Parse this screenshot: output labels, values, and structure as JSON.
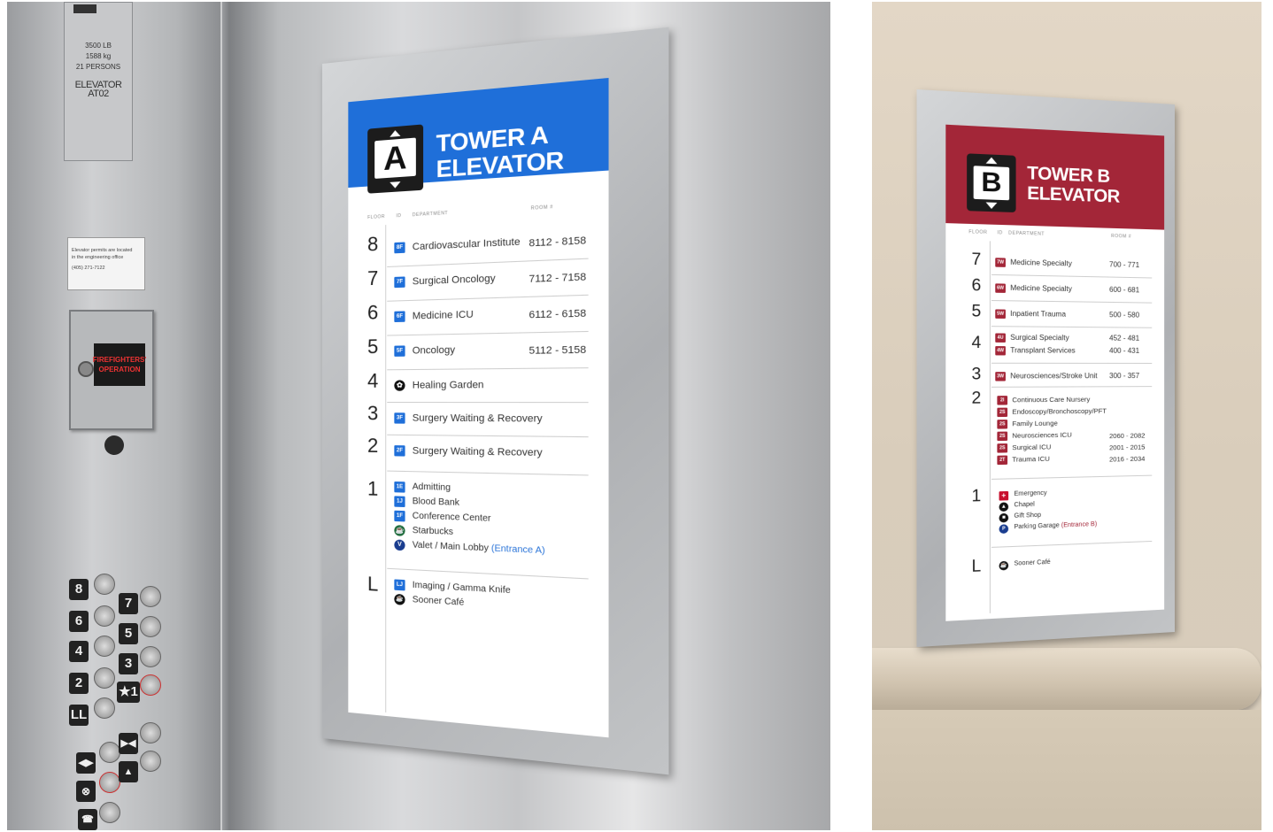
{
  "photo_a": {
    "elevator_panel": {
      "capacity_lines": [
        "3500 LB",
        "1588 kg",
        "21 PERSONS"
      ],
      "elevator_id": "ELEVATOR AT02",
      "notice_lines": [
        "Elevator permits are located",
        "in the engineering office",
        "(405) 271-7122"
      ],
      "fire_label_lines": [
        "FIREFIGHTERS'",
        "OPERATION"
      ],
      "buttons": [
        "8",
        "7",
        "6",
        "5",
        "4",
        "3",
        "2",
        "★1",
        "LL"
      ]
    },
    "sign": {
      "accent_color": "#1f6fd9",
      "emblem_letter": "A",
      "title_lines": [
        "TOWER A",
        "ELEVATOR"
      ],
      "columns": [
        "FLOOR",
        "ID",
        "DEPARTMENT",
        "ROOM #"
      ],
      "floors": [
        {
          "floor": "8",
          "items": [
            {
              "id": "8F",
              "dept": "Cardiovascular Institute",
              "room": "8112 - 8158"
            }
          ]
        },
        {
          "floor": "7",
          "items": [
            {
              "id": "7F",
              "dept": "Surgical Oncology",
              "room": "7112 - 7158"
            }
          ]
        },
        {
          "floor": "6",
          "items": [
            {
              "id": "6F",
              "dept": "Medicine ICU",
              "room": "6112 - 6158"
            }
          ]
        },
        {
          "floor": "5",
          "items": [
            {
              "id": "5F",
              "dept": "Oncology",
              "room": "5112 - 5158"
            }
          ]
        },
        {
          "floor": "4",
          "items": [
            {
              "id": "garden-icon",
              "dept": "Healing Garden",
              "room": ""
            }
          ]
        },
        {
          "floor": "3",
          "items": [
            {
              "id": "3F",
              "dept": "Surgery Waiting & Recovery",
              "room": ""
            }
          ]
        },
        {
          "floor": "2",
          "items": [
            {
              "id": "2F",
              "dept": "Surgery Waiting & Recovery",
              "room": ""
            }
          ]
        },
        {
          "floor": "1",
          "items": [
            {
              "id": "1E",
              "dept": "Admitting",
              "room": ""
            },
            {
              "id": "1J",
              "dept": "Blood Bank",
              "room": ""
            },
            {
              "id": "1F",
              "dept": "Conference Center",
              "room": ""
            },
            {
              "id": "starbucks-icon",
              "dept": "Starbucks",
              "room": ""
            },
            {
              "id": "valet-icon",
              "dept": "Valet / Main Lobby",
              "room": "",
              "note": "(Entrance A)"
            }
          ]
        },
        {
          "floor": "L",
          "items": [
            {
              "id": "LJ",
              "dept": "Imaging / Gamma Knife",
              "room": ""
            },
            {
              "id": "cafe-icon",
              "dept": "Sooner Café",
              "room": ""
            }
          ]
        }
      ]
    }
  },
  "photo_b": {
    "sign": {
      "accent_color": "#a32638",
      "emblem_letter": "B",
      "title_lines": [
        "TOWER B",
        "ELEVATOR"
      ],
      "columns": [
        "FLOOR",
        "ID",
        "DEPARTMENT",
        "ROOM #"
      ],
      "floors": [
        {
          "floor": "7",
          "items": [
            {
              "id": "7W",
              "dept": "Medicine Specialty",
              "room": "700 - 771"
            }
          ]
        },
        {
          "floor": "6",
          "items": [
            {
              "id": "6W",
              "dept": "Medicine Specialty",
              "room": "600 - 681"
            }
          ]
        },
        {
          "floor": "5",
          "items": [
            {
              "id": "5W",
              "dept": "Inpatient Trauma",
              "room": "500 - 580"
            }
          ]
        },
        {
          "floor": "4",
          "items": [
            {
              "id": "4U",
              "dept": "Surgical Specialty",
              "room": "452 - 481"
            },
            {
              "id": "4W",
              "dept": "Transplant Services",
              "room": "400 - 431"
            }
          ]
        },
        {
          "floor": "3",
          "items": [
            {
              "id": "3W",
              "dept": "Neurosciences/Stroke Unit",
              "room": "300 - 357"
            }
          ]
        },
        {
          "floor": "2",
          "items": [
            {
              "id": "2I",
              "dept": "Continuous Care Nursery",
              "room": ""
            },
            {
              "id": "2S",
              "dept": "Endoscopy/Bronchoscopy/PFT",
              "room": ""
            },
            {
              "id": "2S",
              "dept": "Family Lounge",
              "room": ""
            },
            {
              "id": "2S",
              "dept": "Neurosciences ICU",
              "room": "2060 - 2082"
            },
            {
              "id": "2S",
              "dept": "Surgical ICU",
              "room": "2001 - 2015"
            },
            {
              "id": "2T",
              "dept": "Trauma ICU",
              "room": "2016 - 2034"
            }
          ]
        },
        {
          "floor": "1",
          "items": [
            {
              "id": "emergency-icon",
              "dept": "Emergency",
              "room": ""
            },
            {
              "id": "chapel-icon",
              "dept": "Chapel",
              "room": ""
            },
            {
              "id": "gift-icon",
              "dept": "Gift Shop",
              "room": ""
            },
            {
              "id": "parking-icon",
              "dept": "Parking Garage",
              "room": "",
              "note": "(Entrance B)"
            }
          ]
        },
        {
          "floor": "L",
          "items": [
            {
              "id": "cafe-icon",
              "dept": "Sooner Café",
              "room": ""
            }
          ]
        }
      ]
    }
  }
}
